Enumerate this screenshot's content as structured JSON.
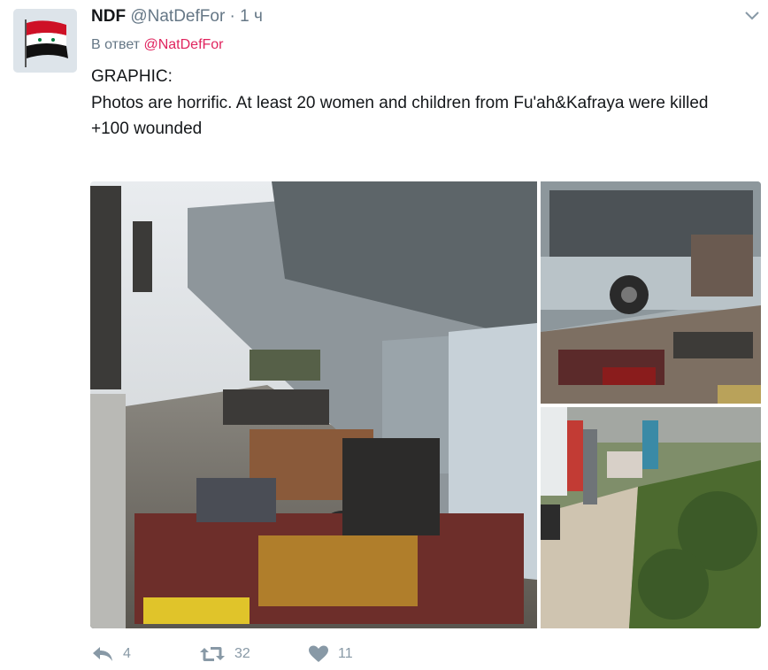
{
  "tweet": {
    "author_name": "NDF",
    "author_handle": "@NatDefFor",
    "separator": " · ",
    "time": "1 ч",
    "reply_prefix": "В ответ",
    "reply_mention": "@NatDefFor",
    "lines": [
      "GRAPHIC:",
      "Photos are horrific. At least 20 women and children from Fu'ah&Kafraya were killed",
      "+100 wounded"
    ]
  },
  "actions": {
    "reply_count": "4",
    "retweet_count": "32",
    "like_count": "11"
  },
  "icons": {
    "avatar": "syrian-flag-avatar",
    "caret": "chevron-down-icon",
    "reply": "reply-icon",
    "retweet": "retweet-icon",
    "like": "heart-icon"
  },
  "colors": {
    "mention": "#e0245e",
    "muted": "#657786",
    "action": "#8899a6"
  }
}
